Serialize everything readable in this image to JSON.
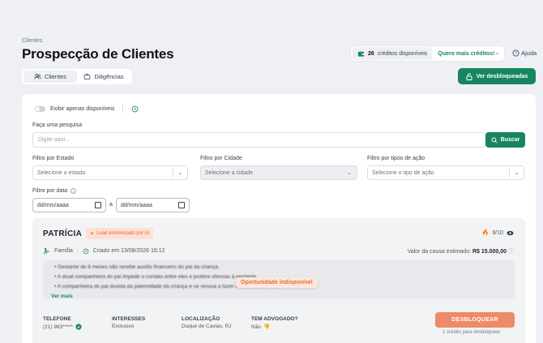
{
  "breadcrumb": "Clientes",
  "page_title": "Prospecção de Clientes",
  "tabs": [
    {
      "label": "Clientes",
      "icon": "users-icon",
      "active": true
    },
    {
      "label": "Diligências",
      "icon": "briefcase-icon",
      "active": false
    }
  ],
  "credits": {
    "count": "26",
    "text": "créditos disponíveis",
    "more_label": "Quero mais créditos!"
  },
  "help_label": "Ajuda",
  "unlocked_button": "Ver desbloqueadas",
  "filters": {
    "toggle_label": "Exibir apenas disponíveis",
    "search_label": "Faça uma pesquisa",
    "search_placeholder": "Digite aqui...",
    "search_button": "Buscar",
    "state_label": "Filtro por Estado",
    "state_placeholder": "Selecione o estado",
    "city_label": "Filtro por Cidade",
    "city_placeholder": "Selecione a cidade",
    "action_label": "Filtro por tipos de ação",
    "action_placeholder": "Selecione o tipo de ação",
    "date_label": "Filtro por data",
    "date_from": "dd/mm/aaaa",
    "date_sep": "a",
    "date_to": "dd/mm/aaaa"
  },
  "lead": {
    "name": "PATRÍCIA",
    "badge": "Lead entrevistado por IA",
    "score": "9/10",
    "area": "Família",
    "created": "Criado em 13/08/2026 16:12",
    "value_label": "Valor da causa estimado:",
    "value": "R$ 15.000,00",
    "bullets": [
      "Gestante de 8 meses não recebe auxílio financeiro do pai da criança.",
      "A atual companheira do pai impede o contato entre eles e profere ofensas à gestante.",
      "A companheira do pai duvida da paternidade da criança e se recusa a fazer o reconhecimento."
    ],
    "ver_mais": "Ver mais",
    "overlay": "Oportunidade indisponível",
    "fields": [
      {
        "label": "TELEFONE",
        "value": "(21) 983*****"
      },
      {
        "label": "INTERESSES",
        "value": "Exclusivo"
      },
      {
        "label": "LOCALIZAÇÃO",
        "value": "Duque de Caxias, RJ"
      },
      {
        "label": "TEM ADVOGADO?",
        "value": "Não"
      }
    ],
    "unlock_button": "DESBLOQUEAR",
    "unlock_note": "1 crédito para desbloquear"
  },
  "colors": {
    "primary": "#17865f",
    "accent": "#ee8a65",
    "background": "#eef0f5"
  }
}
